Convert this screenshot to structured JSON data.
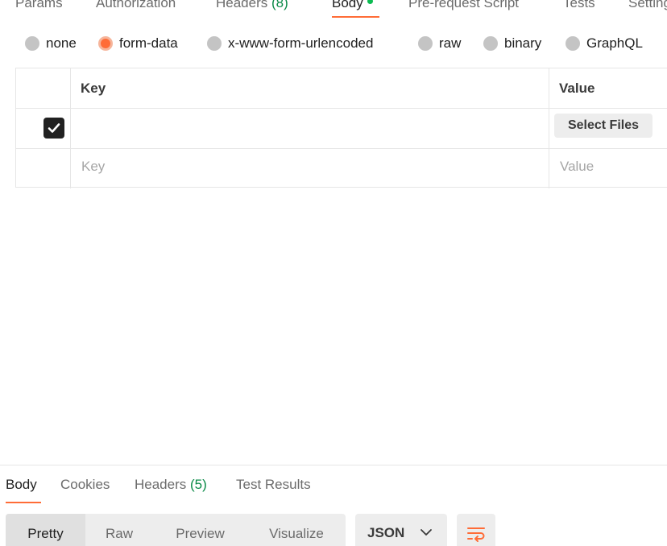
{
  "request_tabs": [
    {
      "label": "Params"
    },
    {
      "label": "Authorization"
    },
    {
      "label": "Headers",
      "count": "(8)"
    },
    {
      "label": "Body"
    },
    {
      "label": "Pre-request Script"
    },
    {
      "label": "Tests"
    },
    {
      "label": "Settings"
    }
  ],
  "active_request_tab": "Body",
  "body_types": [
    {
      "label": "none",
      "selected": false
    },
    {
      "label": "form-data",
      "selected": true
    },
    {
      "label": "x-www-form-urlencoded",
      "selected": false
    },
    {
      "label": "raw",
      "selected": false
    },
    {
      "label": "binary",
      "selected": false
    },
    {
      "label": "GraphQL",
      "selected": false
    }
  ],
  "form_table": {
    "headers": {
      "key": "Key",
      "value": "Value"
    },
    "rows": [
      {
        "checked": true,
        "key": "",
        "value_button": "Select Files"
      }
    ],
    "new_row": {
      "key_placeholder": "Key",
      "value_placeholder": "Value"
    }
  },
  "response_tabs": [
    {
      "label": "Body"
    },
    {
      "label": "Cookies"
    },
    {
      "label": "Headers",
      "count": "(5)"
    },
    {
      "label": "Test Results"
    }
  ],
  "active_response_tab": "Body",
  "view_modes": [
    {
      "label": "Pretty",
      "active": true
    },
    {
      "label": "Raw",
      "active": false
    },
    {
      "label": "Preview",
      "active": false
    },
    {
      "label": "Visualize",
      "active": false
    }
  ],
  "format_select": {
    "value": "JSON"
  },
  "icons": {
    "wrap": "wrap-lines-icon",
    "dropdown": "chevron-down-icon",
    "check": "check-icon"
  },
  "colors": {
    "accent": "#ff6c37",
    "count": "#0a8a47",
    "status_dot": "#0cbb52"
  }
}
